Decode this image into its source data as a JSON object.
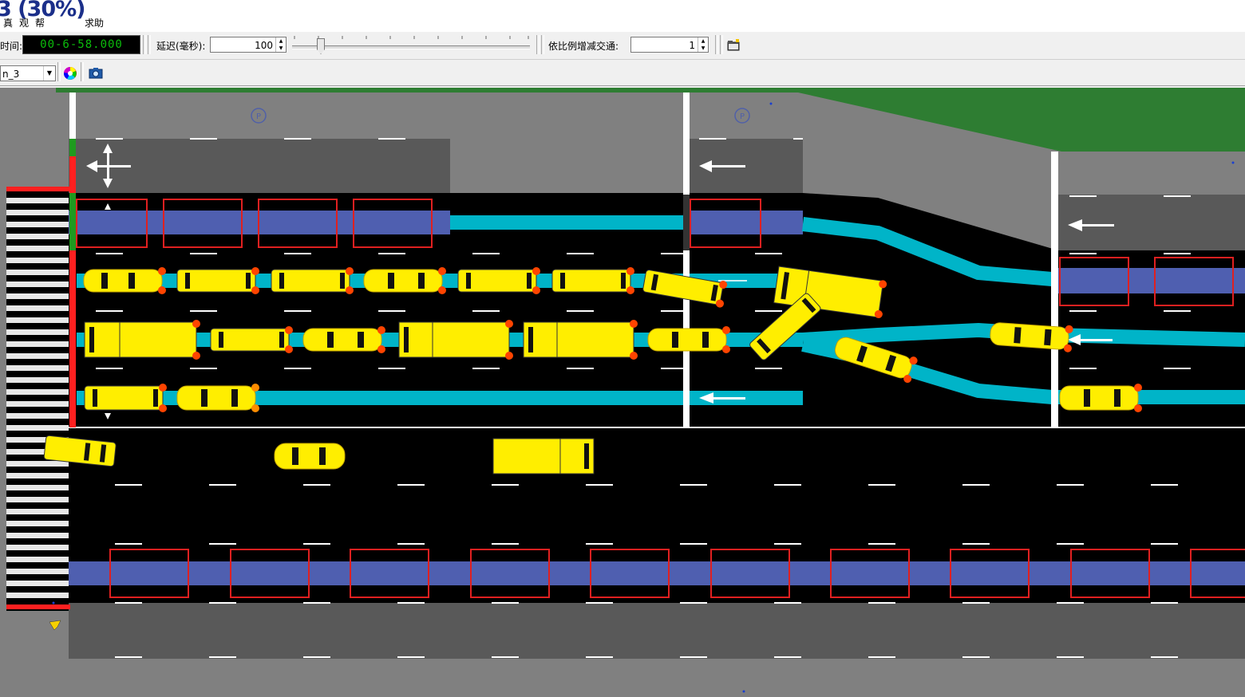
{
  "window": {
    "zoom_text": "3 (30%)",
    "menu_items": [
      "真",
      "观",
      "帮",
      "求助"
    ]
  },
  "toolbar": {
    "time_label": "时间:",
    "clock_value": "00-6-58.000",
    "delay_label": "延迟(毫秒):",
    "delay_value": "100",
    "scale_label": "依比例增减交通:",
    "scale_value": "1"
  },
  "toolbar2": {
    "layer_value": "n_3"
  },
  "icons": [
    "spinner-arrows-icon",
    "folder-icon",
    "color-wheel-icon",
    "camera-icon",
    "dropdown-arrow-icon",
    "parking-icon",
    "lane-arrow-icon"
  ],
  "canvas": {
    "parking_signs": [
      "P",
      "P"
    ],
    "colors": {
      "road": "#000000",
      "sidewalk": "#808080",
      "grass": "#2e7d32",
      "bus_lane": "#4f5fb0",
      "lane_path": "#00b4c8",
      "vehicle": "#ffee00",
      "signal_red": "#ff2020",
      "signal_green": "#1f9a1f",
      "detector": "#e02020"
    }
  }
}
